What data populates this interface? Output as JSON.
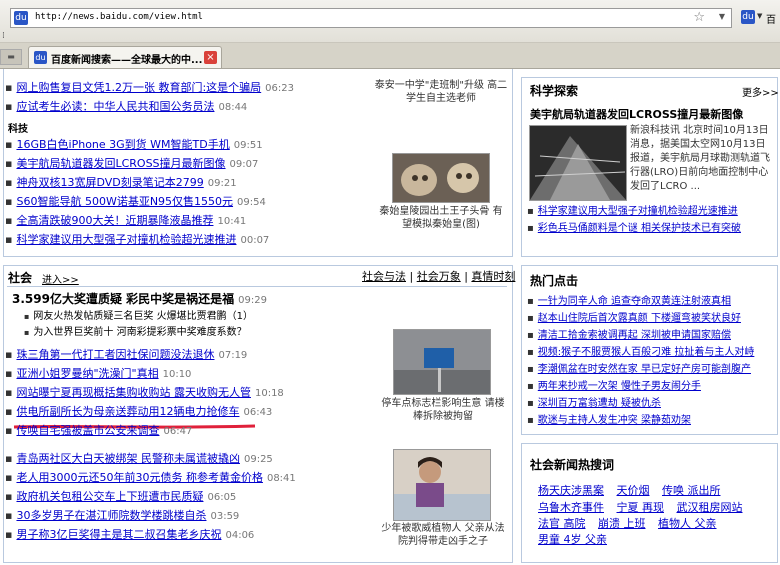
{
  "browser": {
    "url": "http://news.baidu.com/view.html",
    "tab_title": "百度新闻搜索——全球最大的中...",
    "favicon_text": "du",
    "search_text": "百",
    "close_glyph": "×"
  },
  "tech_top": {
    "items": [
      {
        "text": "网上购售复目文凭1.2万一张 教育部门:这是个骗局",
        "time": "06:23"
      },
      {
        "text": "应试考生必读：中华人民共和国公务员法",
        "time": "08:44"
      }
    ],
    "label": "科技",
    "tech_items": [
      {
        "text": "16GB白色iPhone 3G到货 WM智能TD手机",
        "time": "09:51"
      },
      {
        "text": "美宇航局轨道器发回LCROSS撞月最新图像",
        "time": "09:07"
      },
      {
        "text": "神舟双核13宽屏DVD刻录笔记本2799",
        "time": "09:21"
      },
      {
        "text": "S60智能导航 500W诺基亚N95仅售1550元",
        "time": "09:54"
      },
      {
        "text": "全高清跌破900大关！近期暴降液晶推荐",
        "time": "10:41"
      },
      {
        "text": "科学家建议用大型强子对撞机检验超光速推进",
        "time": "00:07"
      }
    ],
    "caption_top": "泰安一中学\"走班制\"升级 高二学生自主选老师",
    "caption_photo": "秦始皇陵园出土王子头骨 有望模拟秦始皇(图)"
  },
  "science": {
    "title": "科学探索",
    "more": "更多>>",
    "headline": "美宇航局轨道器发回LCROSS撞月最新图像",
    "summary": "新浪科技讯 北京时间10月13日消息，据美国太空网10月13日报道，美宇航局月球勘测轨道飞行器(LRO)日前向地面控制中心发回了LCRO ...",
    "items": [
      {
        "text": "科学家建议用大型强子对撞机检验超光速推进"
      },
      {
        "text": "彩色兵马俑颜料是个谜 相关保护技术已有突破"
      }
    ]
  },
  "society": {
    "title": "社会",
    "enter": "进入>>",
    "links": [
      "社会与法",
      "社会万象",
      "真情时刻"
    ],
    "headline": "3.599亿大奖遭质疑 彩民中奖是祸还是福",
    "headline_time": "09:29",
    "sub_items": [
      {
        "text": "网友火热发帖质疑三名巨奖 火爆堪比贾君鹏（1）"
      },
      {
        "text": "为入世界巨奖前十 河南彩提彩票中奖难度系数？"
      }
    ],
    "items": [
      {
        "text": "珠三角第一代打工者因社保问题没法退休",
        "time": "07:19"
      },
      {
        "text": "亚洲小姐罗曼纳\"洗澡门\"真相",
        "time": "10:10"
      },
      {
        "text": "网站曝宁夏再现概括集购收购站 露天收购无人管",
        "time": "10:18"
      },
      {
        "text": "供电所副所长为母亲送葬动用12辆电力抢修车",
        "time": "06:43"
      },
      {
        "text": "传唤自宅强被盖市公安来调查",
        "time": "06:47"
      }
    ],
    "items2": [
      {
        "text": "青岛两社区大白天被绑架 民警称未属谎被撬凶",
        "time": "09:25"
      },
      {
        "text": "老人用3000元还50年前30元债务 称参考黄金价格",
        "time": "08:41"
      },
      {
        "text": "政府机关包租公交车上下班遭市民质疑",
        "time": "06:05"
      },
      {
        "text": "30多岁男子在湛江师院数学楼跳楼自杀",
        "time": "03:59"
      },
      {
        "text": "男子称3亿巨奖得主是其二叔召集老乡庆祝",
        "time": "04:06"
      }
    ],
    "caption_sign": "停车点标志栏影响生意 请楼棒拆除被拘留",
    "caption_woman": "少年被歌威植物人 父亲从法院判得带走凶手之子"
  },
  "hot": {
    "title": "热门点击",
    "items": [
      {
        "text": "一针为同辛人命 追查夺命双黄连注射液真相"
      },
      {
        "text": "赵本山住院后首次露真颜 下楼遛弯被笑状良好"
      },
      {
        "text": "清洁工拾金索被调再起 深圳被申请国家赔偿"
      },
      {
        "text": "视频:猴子不服贾猴人百般刁难 拉扯着与主人对峙"
      },
      {
        "text": "李潮佩盆在时安然在家 早已定好产房可能剖腹产"
      },
      {
        "text": "两年来抄戒一次架 慢性子男友闹分手"
      },
      {
        "text": "深圳百万富翁遭劫 疑被仇杀"
      },
      {
        "text": "歌迷与主持人发生冲突 梁静茹劝架"
      }
    ]
  },
  "hot_search": {
    "title": "社会新闻热搜词",
    "rows": [
      [
        "杨天庆涉黑案",
        "天价烟",
        "传唤 派出所"
      ],
      [
        "乌鲁木齐事件",
        "宁夏 再现",
        "武汉租房网站"
      ],
      [
        "法官 高院",
        "崩溃 上班",
        "植物人 父亲"
      ],
      [
        "男童 4岁 父亲"
      ]
    ]
  },
  "colors": {
    "link": "#0000cc",
    "border": "#b9c9df",
    "underline_mark": "#e0203a"
  }
}
